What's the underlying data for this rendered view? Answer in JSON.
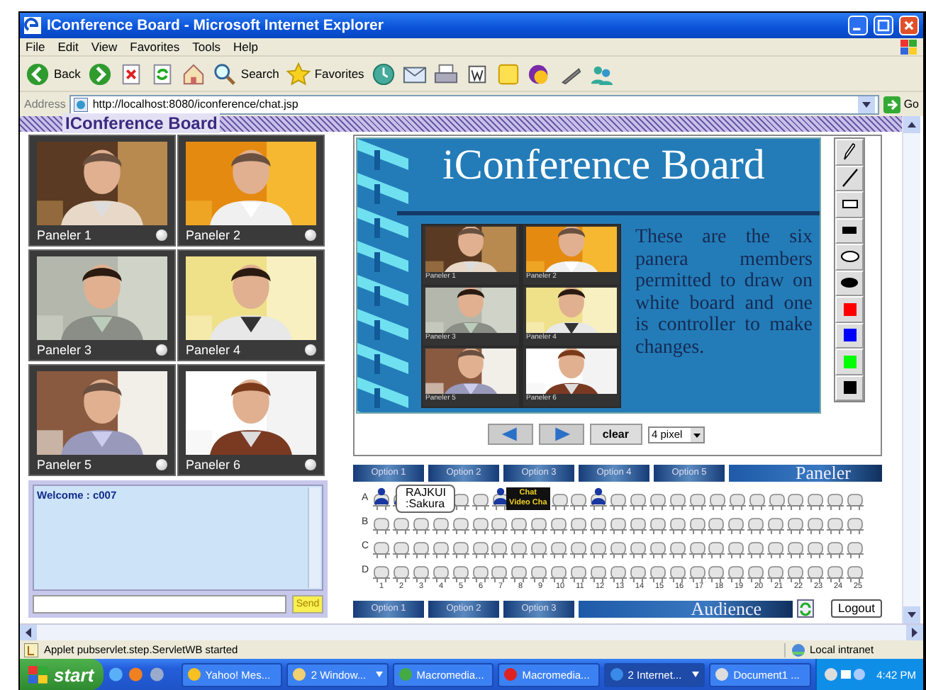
{
  "window": {
    "title": "IConference Board - Microsoft Internet Explorer"
  },
  "menu": [
    "File",
    "Edit",
    "View",
    "Favorites",
    "Tools",
    "Help"
  ],
  "toolbar": [
    {
      "kind": "back",
      "label": "Back"
    },
    {
      "kind": "forward"
    },
    {
      "kind": "stop"
    },
    {
      "kind": "refresh"
    },
    {
      "kind": "home"
    },
    {
      "kind": "search",
      "label": "Search"
    },
    {
      "kind": "favorites",
      "label": "Favorites"
    },
    {
      "kind": "history"
    },
    {
      "kind": "mail"
    },
    {
      "kind": "print"
    },
    {
      "kind": "edit"
    },
    {
      "kind": "note"
    },
    {
      "kind": "messenger"
    },
    {
      "kind": "research"
    },
    {
      "kind": "contacts"
    }
  ],
  "address": {
    "label": "Address",
    "url": "http://localhost:8080/iconference/chat.jsp",
    "go": "Go"
  },
  "page": {
    "header": "IConference Board",
    "panelers": [
      {
        "name": "Paneler 1"
      },
      {
        "name": "Paneler 2"
      },
      {
        "name": "Paneler 3"
      },
      {
        "name": "Paneler 4"
      },
      {
        "name": "Paneler 5"
      },
      {
        "name": "Paneler 6"
      }
    ],
    "chat": {
      "messages": [
        "Welcome : c007"
      ],
      "send": "Send"
    },
    "board": {
      "title": "iConference Board",
      "thumbnails": [
        "Paneler 1",
        "Paneler 2",
        "Paneler 3",
        "Paneler 4",
        "Paneler 5",
        "Paneler 6"
      ],
      "text": "These are the six panera members permitted to draw on white board and one is controller to make changes.",
      "tools": [
        {
          "kind": "pencil"
        },
        {
          "kind": "line"
        },
        {
          "kind": "rect"
        },
        {
          "kind": "rectfill"
        },
        {
          "kind": "oval"
        },
        {
          "kind": "ovalfill"
        },
        {
          "kind": "color",
          "color": "#ff0000"
        },
        {
          "kind": "color",
          "color": "#0000ff"
        },
        {
          "kind": "color",
          "color": "#00ff00"
        },
        {
          "kind": "color",
          "color": "#000000"
        }
      ],
      "clear": "clear",
      "stroke": "4 pixel"
    },
    "paneler_bar": {
      "options": [
        "Option 1",
        "Option 2",
        "Option 3",
        "Option 4",
        "Option 5"
      ],
      "title": "Paneler"
    },
    "seating": {
      "rows": [
        {
          "label": "A",
          "seats": [
            {
              "occupied": true
            },
            {
              "occupied": true
            },
            {
              "kind": "covered"
            },
            {
              "kind": "covered"
            },
            {
              "occupied": false
            },
            {
              "occupied": false
            },
            {
              "occupied": true
            },
            {
              "kind": "covered"
            },
            {
              "kind": "covered"
            },
            {
              "occupied": false
            },
            {
              "occupied": false
            },
            {
              "occupied": true
            },
            {
              "occupied": false
            },
            {
              "occupied": false
            },
            {
              "occupied": false
            },
            {
              "occupied": false
            },
            {
              "occupied": false
            },
            {
              "occupied": false
            },
            {
              "occupied": false
            },
            {
              "occupied": false
            },
            {
              "occupied": false
            },
            {
              "occupied": false
            },
            {
              "occupied": false
            },
            {
              "occupied": false
            },
            {
              "occupied": false
            }
          ]
        },
        {
          "label": "B",
          "seats": [
            {
              "occupied": false
            },
            {
              "occupied": false
            },
            {
              "occupied": false
            },
            {
              "occupied": false
            },
            {
              "occupied": false
            },
            {
              "occupied": false
            },
            {
              "occupied": false
            },
            {
              "occupied": false
            },
            {
              "occupied": false
            },
            {
              "occupied": false
            },
            {
              "occupied": false
            },
            {
              "occupied": false
            },
            {
              "occupied": false
            },
            {
              "occupied": false
            },
            {
              "occupied": false
            },
            {
              "occupied": false
            },
            {
              "occupied": false
            },
            {
              "occupied": false
            },
            {
              "occupied": false
            },
            {
              "occupied": false
            },
            {
              "occupied": false
            },
            {
              "occupied": false
            },
            {
              "occupied": false
            },
            {
              "occupied": false
            },
            {
              "occupied": false
            }
          ]
        },
        {
          "label": "C",
          "seats": [
            {
              "occupied": false
            },
            {
              "occupied": false
            },
            {
              "occupied": false
            },
            {
              "occupied": false
            },
            {
              "occupied": false
            },
            {
              "occupied": false
            },
            {
              "occupied": false
            },
            {
              "occupied": false
            },
            {
              "occupied": false
            },
            {
              "occupied": false
            },
            {
              "occupied": false
            },
            {
              "occupied": false
            },
            {
              "occupied": false
            },
            {
              "occupied": false
            },
            {
              "occupied": false
            },
            {
              "occupied": false
            },
            {
              "occupied": false
            },
            {
              "occupied": false
            },
            {
              "occupied": false
            },
            {
              "occupied": false
            },
            {
              "occupied": false
            },
            {
              "occupied": false
            },
            {
              "occupied": false
            },
            {
              "occupied": false
            },
            {
              "occupied": false
            }
          ]
        },
        {
          "label": "D",
          "seats": [
            {
              "occupied": false
            },
            {
              "occupied": false
            },
            {
              "occupied": false
            },
            {
              "occupied": false
            },
            {
              "occupied": false
            },
            {
              "occupied": false
            },
            {
              "occupied": false
            },
            {
              "occupied": false
            },
            {
              "occupied": false
            },
            {
              "occupied": false
            },
            {
              "occupied": false
            },
            {
              "occupied": false
            },
            {
              "occupied": false
            },
            {
              "occupied": false
            },
            {
              "occupied": false
            },
            {
              "occupied": false
            },
            {
              "occupied": false
            },
            {
              "occupied": false
            },
            {
              "occupied": false
            },
            {
              "occupied": false
            },
            {
              "occupied": false
            },
            {
              "occupied": false
            },
            {
              "occupied": false
            },
            {
              "occupied": false
            },
            {
              "occupied": false
            }
          ]
        }
      ],
      "numbers": [
        "1",
        "2",
        "3",
        "4",
        "5",
        "6",
        "7",
        "8",
        "9",
        "10",
        "11",
        "12",
        "13",
        "14",
        "15",
        "16",
        "17",
        "18",
        "19",
        "20",
        "21",
        "22",
        "23",
        "24",
        "25"
      ],
      "tooltip": [
        "RAJKUI",
        ":Sakura"
      ],
      "popup": [
        "Chat",
        "Video Cha"
      ]
    },
    "audience_bar": {
      "options": [
        "Option 1",
        "Option 2",
        "Option 3"
      ],
      "title": "Audience",
      "logout": "Logout"
    }
  },
  "status_bar": {
    "text": "Applet pubservlet.step.ServletWB started",
    "zone": "Local intranet"
  },
  "taskbar": {
    "start": "start",
    "tasks": [
      {
        "label": "Yahoo! Mes...",
        "grouped": false,
        "selected": false
      },
      {
        "label": "2 Window...",
        "grouped": true,
        "selected": false
      },
      {
        "label": "Macromedia...",
        "grouped": false,
        "selected": false
      },
      {
        "label": "Macromedia...",
        "grouped": false,
        "selected": false
      },
      {
        "label": "2 Internet...",
        "grouped": true,
        "selected": true
      },
      {
        "label": "Document1 ...",
        "grouped": false,
        "selected": false
      }
    ],
    "clock": "4:42 PM"
  }
}
